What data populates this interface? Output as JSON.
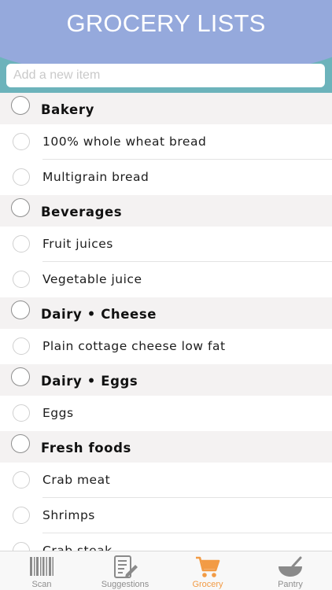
{
  "header": {
    "title": "GROCERY LISTS"
  },
  "search": {
    "placeholder": "Add a new item"
  },
  "colors": {
    "header_blue": "#95a9dc",
    "header_teal": "#6cb3bb",
    "active_tab": "#f29b45",
    "bakery": "#f4c331",
    "beverages": "#e0306b",
    "dairy_cheese": "#8da3d6",
    "dairy_eggs": "#d9e1f3",
    "fresh_foods": "#c53fd0"
  },
  "categories": [
    {
      "name": "Bakery",
      "items": [
        "100% whole wheat bread",
        "Multigrain bread"
      ]
    },
    {
      "name": "Beverages",
      "items": [
        "Fruit juices",
        "Vegetable juice"
      ]
    },
    {
      "name": "Dairy • Cheese",
      "items": [
        "Plain cottage cheese low fat"
      ]
    },
    {
      "name": "Dairy • Eggs",
      "items": [
        "Eggs"
      ]
    },
    {
      "name": "Fresh foods",
      "items": [
        "Crab meat",
        "Shrimps",
        "Crab steak"
      ]
    }
  ],
  "tabs": [
    {
      "label": "Scan",
      "icon": "barcode-icon",
      "active": false
    },
    {
      "label": "Suggestions",
      "icon": "suggestions-list-icon",
      "active": false
    },
    {
      "label": "Grocery",
      "icon": "cart-icon",
      "active": true
    },
    {
      "label": "Pantry",
      "icon": "pantry-bowl-icon",
      "active": false
    }
  ]
}
